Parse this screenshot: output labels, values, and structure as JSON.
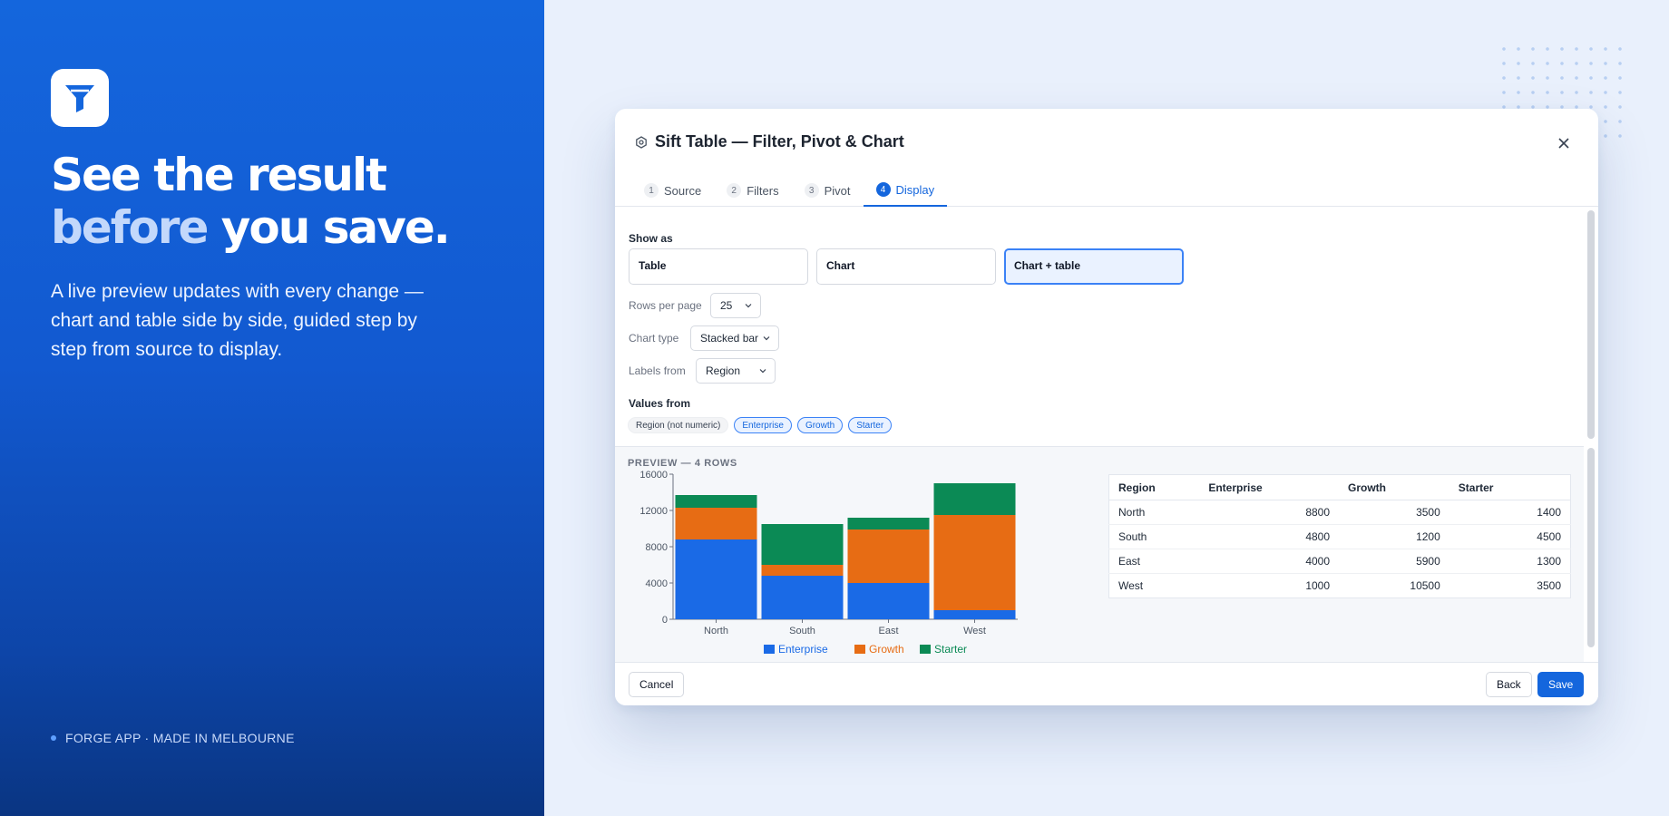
{
  "hero": {
    "headline_line1": "See the result",
    "headline_word": "before",
    "headline_rest": " you save.",
    "subtext": "A live preview updates with every change — chart and table side by side, guided step by step from source to display.",
    "footer": "FORGE APP · MADE IN MELBOURNE",
    "logo_icon": "funnel-icon"
  },
  "dialog": {
    "title": "Sift Table — Filter, Pivot & Chart",
    "tabs": [
      {
        "num": "1",
        "label": "Source"
      },
      {
        "num": "2",
        "label": "Filters"
      },
      {
        "num": "3",
        "label": "Pivot"
      },
      {
        "num": "4",
        "label": "Display",
        "active": true
      }
    ],
    "show_as_label": "Show as",
    "show_options": [
      "Table",
      "Chart",
      "Chart + table"
    ],
    "show_selected": "Chart + table",
    "rows_per_page_label": "Rows per page",
    "rows_per_page_value": "25",
    "chart_type_label": "Chart type",
    "chart_type_value": "Stacked bar",
    "labels_from_label": "Labels from",
    "labels_from_value": "Region",
    "values_from_label": "Values from",
    "values_chips": [
      {
        "label": "Region (not numeric)",
        "selected": false
      },
      {
        "label": "Enterprise",
        "selected": true
      },
      {
        "label": "Growth",
        "selected": true
      },
      {
        "label": "Starter",
        "selected": true
      }
    ],
    "preview_label": "PREVIEW — 4 ROWS",
    "table": {
      "headers": [
        "Region",
        "Enterprise",
        "Growth",
        "Starter"
      ],
      "rows": [
        [
          "North",
          "8800",
          "3500",
          "1400"
        ],
        [
          "South",
          "4800",
          "1200",
          "4500"
        ],
        [
          "East",
          "4000",
          "5900",
          "1300"
        ],
        [
          "West",
          "1000",
          "10500",
          "3500"
        ]
      ]
    },
    "footer": {
      "cancel": "Cancel",
      "back": "Back",
      "save": "Save"
    }
  },
  "colors": {
    "accent": "#1466dd",
    "enterprise": "#1a6ae6",
    "growth": "#e76c14",
    "starter": "#0b8a55"
  },
  "chart_data": {
    "type": "bar",
    "stacked": true,
    "categories": [
      "North",
      "South",
      "East",
      "West"
    ],
    "series": [
      {
        "name": "Enterprise",
        "values": [
          8800,
          4800,
          4000,
          1000
        ]
      },
      {
        "name": "Growth",
        "values": [
          3500,
          1200,
          5900,
          10500
        ]
      },
      {
        "name": "Starter",
        "values": [
          1400,
          4500,
          1300,
          3500
        ]
      }
    ],
    "yticks": [
      "0",
      "4000",
      "8000",
      "12000",
      "16000"
    ],
    "ylim": [
      0,
      16000
    ],
    "legend": "bottom"
  }
}
